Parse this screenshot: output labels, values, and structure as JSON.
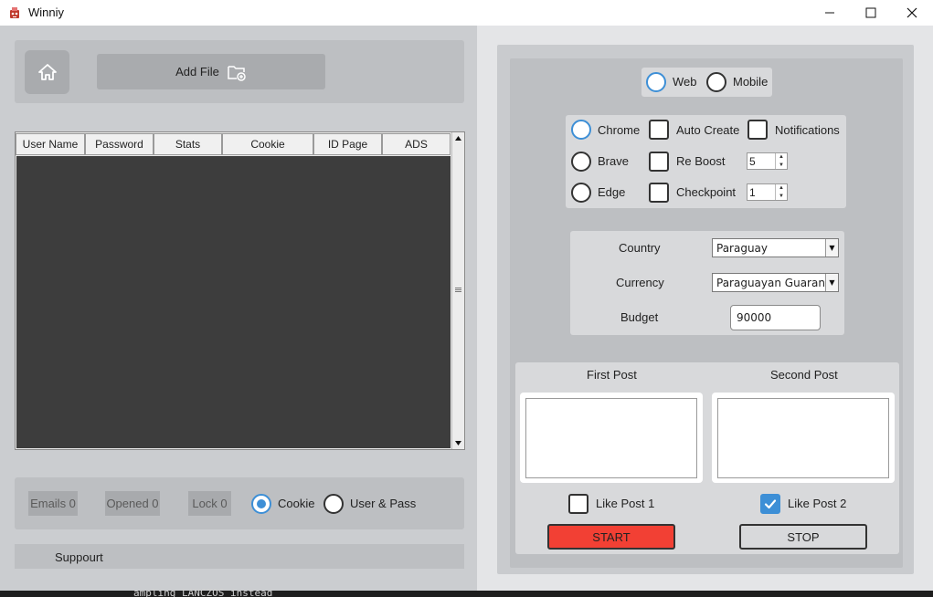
{
  "window": {
    "title": "Winniy",
    "minimize": "—",
    "maximize": "☐",
    "close": "✕"
  },
  "toolbar": {
    "home_icon": "home-icon",
    "add_file_label": "Add File",
    "add_file_icon": "folder-add-icon"
  },
  "table": {
    "columns": [
      "User Name",
      "Password",
      "Stats",
      "Cookie",
      "ID Page",
      "ADS"
    ],
    "rows": []
  },
  "stats": {
    "emails": "Emails 0",
    "opened": "Opened 0",
    "lock": "Lock 0"
  },
  "login_mode": {
    "options": [
      "Cookie",
      "User & Pass"
    ],
    "selected": "Cookie"
  },
  "support": {
    "label": "Suppourt"
  },
  "platform": {
    "options": [
      "Web",
      "Mobile"
    ],
    "selected": "Web"
  },
  "browser": {
    "options": [
      "Chrome",
      "Brave",
      "Edge"
    ],
    "selected": "Chrome"
  },
  "options": {
    "auto_create": "Auto Create",
    "notifications": "Notifications",
    "re_boost": "Re Boost",
    "checkpoint": "Checkpoint",
    "re_boost_value": "5",
    "checkpoint_value": "1"
  },
  "form": {
    "country_label": "Country",
    "country_value": "Paraguay",
    "currency_label": "Currency",
    "currency_value": "Paraguayan Guarani",
    "budget_label": "Budget",
    "budget_value": "90000"
  },
  "posts": {
    "first_label": "First Post",
    "second_label": "Second Post",
    "first_text": "",
    "second_text": "",
    "like1_label": "Like Post 1",
    "like1_checked": false,
    "like2_label": "Like Post 2",
    "like2_checked": true
  },
  "actions": {
    "start_label": "START",
    "stop_label": "STOP"
  },
  "colors": {
    "start_bg": "#f24034",
    "accent": "#3d8fd6",
    "table_body": "#3d3d3d"
  },
  "console_text": "ampling LANCZOS instead"
}
